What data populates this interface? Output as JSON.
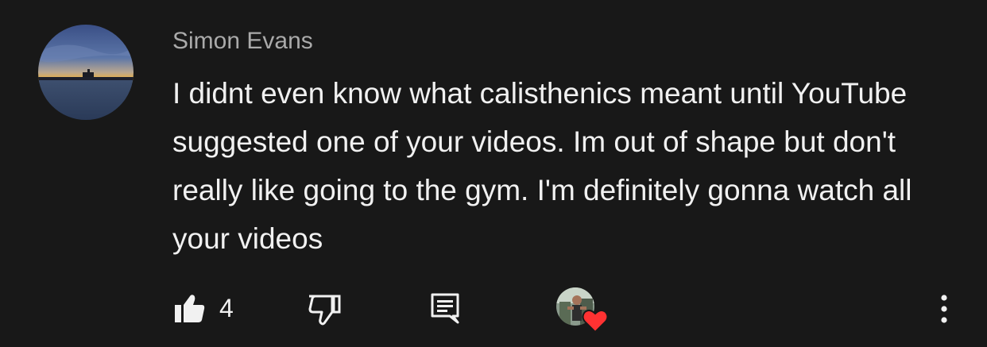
{
  "comment": {
    "author": "Simon Evans",
    "text": "I didnt even know what calisthenics meant until YouTube suggested one of your videos. Im out of shape but don't really like going to the gym. I'm definitely gonna watch all your videos",
    "avatar_icon": "sunset-sea-avatar"
  },
  "actions": {
    "like_icon": "thumbs-up-filled-icon",
    "like_count": "4",
    "dislike_icon": "thumbs-down-outline-icon",
    "reply_icon": "reply-comment-icon",
    "creator_heart_icon": "heart-icon",
    "more_icon": "more-vertical-icon"
  },
  "colors": {
    "background": "#181818",
    "text": "#f1f1f1",
    "author": "#aaaaaa",
    "heart": "#ff3232"
  }
}
